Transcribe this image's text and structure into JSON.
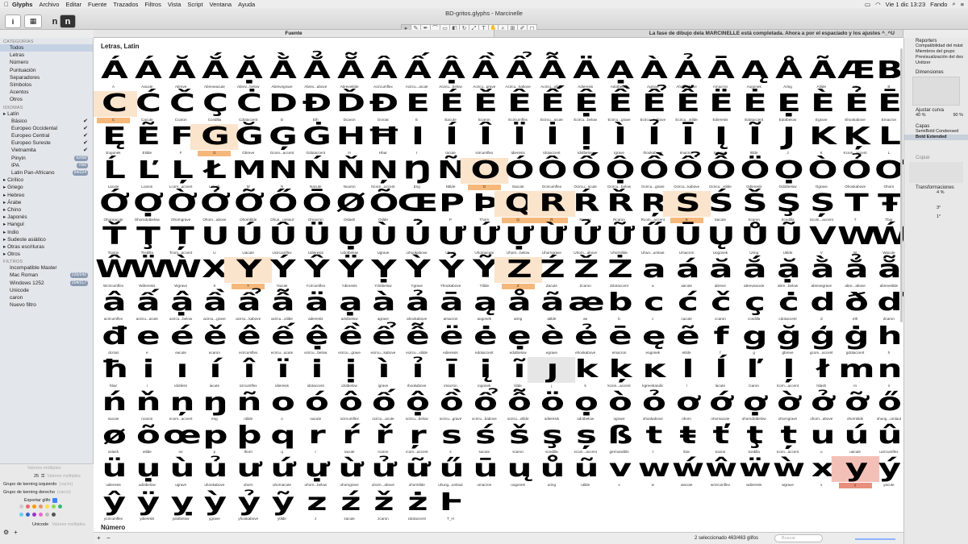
{
  "menubar": {
    "apple": "",
    "items": [
      "Glyphs",
      "Archivo",
      "Editar",
      "Fuente",
      "Trazados",
      "Filtros",
      "Vista",
      "Script",
      "Ventana",
      "Ayuda"
    ],
    "clock": "Vie 1 dic  13:23",
    "user": "Fando"
  },
  "window": {
    "title": "BD-gritos.glyphs - Marcinelle",
    "tabs": [
      "Fuente",
      "La fase de dibujo dela MARCINELLE está  completada. Ahora a por el espaciado y los ajustes ^_^U"
    ]
  },
  "sidebar": {
    "categories_head": "CATEGORÍAS",
    "categories": [
      {
        "label": "Todos",
        "selected": true
      },
      {
        "label": "Letras"
      },
      {
        "label": "Número"
      },
      {
        "label": "Puntuación"
      },
      {
        "label": "Separadores"
      },
      {
        "label": "Símbolos"
      },
      {
        "label": "Acentos"
      },
      {
        "label": "Otros"
      }
    ],
    "languages_head": "IDIOMAS",
    "languages": [
      {
        "label": "Latín",
        "sub": false
      },
      {
        "label": "Básico",
        "sub": true,
        "check": "✔"
      },
      {
        "label": "Europeo Occidental",
        "sub": true,
        "check": "✔"
      },
      {
        "label": "Europeo Central",
        "sub": true,
        "check": "✔"
      },
      {
        "label": "Europeo Sureste",
        "sub": true,
        "check": "✔"
      },
      {
        "label": "Vietnamita",
        "sub": true,
        "check": "✔"
      },
      {
        "label": "Pinyin",
        "sub": true,
        "count": "62/68"
      },
      {
        "label": "IPA",
        "sub": true,
        "count": "7/66"
      },
      {
        "label": "Latin Pan-Africano",
        "sub": true,
        "count": "64/224"
      },
      {
        "label": "Cirílico"
      },
      {
        "label": "Griego"
      },
      {
        "label": "Hebreo"
      },
      {
        "label": "Árabe"
      },
      {
        "label": "Chino"
      },
      {
        "label": "Japonés"
      },
      {
        "label": "Hangul"
      },
      {
        "label": "Indio"
      },
      {
        "label": "Sudeste asiático"
      },
      {
        "label": "Otras escrituras"
      },
      {
        "label": "Otros"
      }
    ],
    "filters_head": "FILTROS",
    "filters": [
      {
        "label": "Incompatible Master"
      },
      {
        "label": "Mac Roman",
        "count": "220/242"
      },
      {
        "label": "Windows 1252",
        "count": "204/217"
      },
      {
        "label": "Unicode"
      },
      {
        "label": "caron"
      },
      {
        "label": "Nuevo filtro"
      }
    ],
    "bottom": {
      "multi1": "Valores múltiples",
      "width_value": "25",
      "multi2": "Valores múltiples",
      "kern_left": "Grupo de kerning izquierdo",
      "kern_left_val": "(vacío)",
      "kern_right": "Grupo de kerning derecho",
      "kern_right_val": "(vacío)",
      "export": "Exportar glifo",
      "unicode": "Unicode",
      "multi3": "Valores múltiples"
    }
  },
  "main": {
    "section1": "Letras, Latin",
    "section2": "Número",
    "footer_count": "2 seleccionado 463/463 glifos",
    "search_placeholder": "Buscar"
  },
  "inspector": {
    "reporters": "Reporters",
    "reporter_items": [
      "Compatibilidad del mást",
      "Miembros del grupo",
      "Previsualización del des",
      "Unitizer"
    ],
    "dimensiones": "Dimensiones",
    "ajustar": "Ajustar curva",
    "ajustar_vals": [
      "40 %",
      "90 %"
    ],
    "capas": "Capas",
    "layers": [
      {
        "label": "SemiBold Condensed",
        "selected": false
      },
      {
        "label": "Bold Extended",
        "selected": true
      }
    ],
    "copiar": "Copiar",
    "transformaciones": "Transformaciones",
    "scale": "4 %",
    "rotate": "3°",
    "slant": "1°"
  },
  "glyph_rows": [
    [
      [
        "Á",
        "A"
      ],
      [
        "Á",
        "Aacute"
      ],
      [
        "Ă",
        "Abreve"
      ],
      [
        "Ắ",
        "Abreveacute"
      ],
      [
        "Ặ",
        "Abrev...below"
      ],
      [
        "Ằ",
        "Abrevegrave"
      ],
      [
        "Ẳ",
        "Abrev...above"
      ],
      [
        "Ẵ",
        "Abrevetilde"
      ],
      [
        "Â",
        "Acircumflex"
      ],
      [
        "Ấ",
        "Acircu...acute"
      ],
      [
        "Ậ",
        "Acircu...below"
      ],
      [
        "Ầ",
        "Acircu...grave"
      ],
      [
        "Ẩ",
        "Acircu...kabove"
      ],
      [
        "Ẫ",
        "Acircu...xtilde"
      ],
      [
        "Ä",
        "Adieresis"
      ],
      [
        "Ạ",
        "Adotbelow"
      ],
      [
        "À",
        "Agrave"
      ],
      [
        "Ả",
        "Ahookabove"
      ],
      [
        "Ā",
        "Amacron"
      ],
      [
        "Ą",
        "Aogonek"
      ],
      [
        "Å",
        "Aring"
      ],
      [
        "Ã",
        "Atilde"
      ],
      [
        "Æ",
        "AE"
      ],
      [
        "B",
        "B"
      ]
    ],
    [
      [
        "C",
        "C",
        "hl"
      ],
      [
        "Ć",
        "Cacute"
      ],
      [
        "Č",
        "Ccaron"
      ],
      [
        "Ç",
        "Ccedilla"
      ],
      [
        "Ċ",
        "Cdotaccent"
      ],
      [
        "D",
        "D"
      ],
      [
        "Ð",
        "Eth"
      ],
      [
        "Ď",
        "Dcaron"
      ],
      [
        "Đ",
        "Dcroat"
      ],
      [
        "E",
        "E"
      ],
      [
        "É",
        "Eacute"
      ],
      [
        "Ě",
        "Ecaron"
      ],
      [
        "Ê",
        "Ecircumflex"
      ],
      [
        "Ế",
        "Ecircu...acute"
      ],
      [
        "Ệ",
        "Ecircu...below"
      ],
      [
        "Ề",
        "Ecircu...grave"
      ],
      [
        "Ể",
        "Ecircu...kabove"
      ],
      [
        "Ễ",
        "Ecircu...xtilde"
      ],
      [
        "Ë",
        "Edieresis"
      ],
      [
        "Ė",
        "Edotaccent"
      ],
      [
        "Ẹ",
        "Edotbelow"
      ],
      [
        "È",
        "Egrave"
      ],
      [
        "Ẻ",
        "Ehookabove"
      ],
      [
        "Ē",
        "Emacron"
      ]
    ],
    [
      [
        "Ę",
        "Eogonek"
      ],
      [
        "Ẽ",
        "Etilde"
      ],
      [
        "F",
        "F"
      ],
      [
        "G",
        "G",
        "hl"
      ],
      [
        "Ğ",
        "Gbreve"
      ],
      [
        "Ģ",
        "Gcom...accent"
      ],
      [
        "Ġ",
        "Gdotaccent"
      ],
      [
        "H",
        "H"
      ],
      [
        "Ħ",
        "Hbar"
      ],
      [
        "I",
        "I"
      ],
      [
        "Í",
        "Iacute"
      ],
      [
        "Î",
        "Icircumflex"
      ],
      [
        "Ï",
        "Idieresis"
      ],
      [
        "İ",
        "Idotaccent"
      ],
      [
        "Ị",
        "Idotbelow"
      ],
      [
        "Ì",
        "Igrave"
      ],
      [
        "Ỉ",
        "Ihookabove"
      ],
      [
        "Ī",
        "Imacron"
      ],
      [
        "Į",
        "Iogonek"
      ],
      [
        "Ĩ",
        "Itilde"
      ],
      [
        "J",
        "J"
      ],
      [
        "K",
        "K"
      ],
      [
        "Ķ",
        "Kcom...accent"
      ],
      [
        "L",
        "L"
      ]
    ],
    [
      [
        "Ĺ",
        "Lacute"
      ],
      [
        "Ľ",
        "Lcaron"
      ],
      [
        "Ļ",
        "Lcom...accent"
      ],
      [
        "Ł",
        "Lslash"
      ],
      [
        "M",
        "M"
      ],
      [
        "N",
        "N"
      ],
      [
        "Ń",
        "Nacute"
      ],
      [
        "Ň",
        "Ncaron"
      ],
      [
        "Ņ",
        "Ncom...accent"
      ],
      [
        "Ŋ",
        "Eng"
      ],
      [
        "Ñ",
        "Ntilde"
      ],
      [
        "O",
        "O",
        "hl"
      ],
      [
        "Ó",
        "Oacute"
      ],
      [
        "Ô",
        "Ocircumflex"
      ],
      [
        "Ố",
        "Ocircu...acute"
      ],
      [
        "Ộ",
        "Ocircu...below"
      ],
      [
        "Ồ",
        "Ocircu...grave"
      ],
      [
        "Ổ",
        "Ocircu...kabove"
      ],
      [
        "Ỗ",
        "Ocircu...xtilde"
      ],
      [
        "Ö",
        "Odieresis"
      ],
      [
        "Ọ",
        "Odotbelow"
      ],
      [
        "Ò",
        "Ograve"
      ],
      [
        "Ỏ",
        "Ohookabove"
      ],
      [
        "Ơ",
        "Ohorn"
      ]
    ],
    [
      [
        "Ớ",
        "Ohornacute"
      ],
      [
        "Ợ",
        "Ohorndotbelow"
      ],
      [
        "Ờ",
        "Ohorngrave"
      ],
      [
        "Ở",
        "Ohorn...above"
      ],
      [
        "Ỡ",
        "Ohorntilde"
      ],
      [
        "Ő",
        "Ohun...umlaut"
      ],
      [
        "Ō",
        "Omacron"
      ],
      [
        "Ø",
        "Oslash"
      ],
      [
        "Õ",
        "Otilde"
      ],
      [
        "Œ",
        "OE"
      ],
      [
        "P",
        "P"
      ],
      [
        "Þ",
        "Thorn"
      ],
      [
        "Q",
        "Q",
        "hl"
      ],
      [
        "R",
        "R",
        "hl"
      ],
      [
        "Ŕ",
        "Racute"
      ],
      [
        "Ř",
        "Rcaron"
      ],
      [
        "Ŗ",
        "Rcom...accent"
      ],
      [
        "S",
        "S",
        "hl"
      ],
      [
        "Ś",
        "Sacute"
      ],
      [
        "Š",
        "Scaron"
      ],
      [
        "Ş",
        "Scedilla"
      ],
      [
        "Ș",
        "Scom...accent"
      ],
      [
        "T",
        "T"
      ],
      [
        "Ŧ",
        "Tbar"
      ]
    ],
    [
      [
        "Ť",
        "Tcaron"
      ],
      [
        "Ţ",
        "Tcedilla"
      ],
      [
        "Ț",
        "Tcom...accent"
      ],
      [
        "U",
        "U"
      ],
      [
        "Ú",
        "Uacute"
      ],
      [
        "Û",
        "Ucircumflex"
      ],
      [
        "Ü",
        "Udieresis"
      ],
      [
        "Ụ",
        "Udotbelow"
      ],
      [
        "Ù",
        "Ugrave"
      ],
      [
        "Ủ",
        "Uhookabove"
      ],
      [
        "Ư",
        "Uhorn"
      ],
      [
        "Ứ",
        "Uhornacute"
      ],
      [
        "Ự",
        "Uhorn...below"
      ],
      [
        "Ừ",
        "Uhorngrave"
      ],
      [
        "Ử",
        "Uhorn...above"
      ],
      [
        "Ữ",
        "Uhorntilde"
      ],
      [
        "Ű",
        "Uhun...umlaut"
      ],
      [
        "Ū",
        "Umacron"
      ],
      [
        "Ų",
        "Uogonek"
      ],
      [
        "Ů",
        "Uring"
      ],
      [
        "Ũ",
        "Utilde"
      ],
      [
        "V",
        "V"
      ],
      [
        "W",
        "W"
      ],
      [
        "Ẃ",
        "Wacute"
      ]
    ],
    [
      [
        "Ŵ",
        "Wcircumflex"
      ],
      [
        "Ẅ",
        "Wdieresis"
      ],
      [
        "Ẁ",
        "Wgrave"
      ],
      [
        "X",
        "X"
      ],
      [
        "Y",
        "Y",
        "hl"
      ],
      [
        "Ý",
        "Yacute"
      ],
      [
        "Ŷ",
        "Ycircumflex"
      ],
      [
        "Ÿ",
        "Ydieresis"
      ],
      [
        "Ỵ",
        "Ydotbelow"
      ],
      [
        "Ỳ",
        "Ygrave"
      ],
      [
        "Ỷ",
        "Yhookabove"
      ],
      [
        "Ỹ",
        "Ytilde"
      ],
      [
        "Z",
        "Z",
        "hl"
      ],
      [
        "Ź",
        "Zacute"
      ],
      [
        "Ž",
        "Zcaron"
      ],
      [
        "Ż",
        "Zdotaccent"
      ],
      [
        "a",
        "a"
      ],
      [
        "á",
        "aacute"
      ],
      [
        "ă",
        "abreve"
      ],
      [
        "ắ",
        "abreveacute"
      ],
      [
        "ặ",
        "abre...below"
      ],
      [
        "ằ",
        "abrevegrave"
      ],
      [
        "ẳ",
        "abre...above"
      ],
      [
        "ẵ",
        "abrevetilde"
      ]
    ],
    [
      [
        "â",
        "acircumflex"
      ],
      [
        "ấ",
        "acircu...acute"
      ],
      [
        "ậ",
        "acircu...below"
      ],
      [
        "ầ",
        "acircu...grave"
      ],
      [
        "ẩ",
        "acircu...kabove"
      ],
      [
        "ẫ",
        "acircu...xtilde"
      ],
      [
        "ä",
        "adieresis"
      ],
      [
        "ạ",
        "adotbelow"
      ],
      [
        "à",
        "agrave"
      ],
      [
        "ả",
        "ahookabove"
      ],
      [
        "ā",
        "amacron"
      ],
      [
        "ą",
        "aogonek"
      ],
      [
        "å",
        "aring"
      ],
      [
        "ã",
        "atilde"
      ],
      [
        "æ",
        "ae"
      ],
      [
        "b",
        "b"
      ],
      [
        "c",
        "c"
      ],
      [
        "ć",
        "cacute"
      ],
      [
        "č",
        "ccaron"
      ],
      [
        "ç",
        "ccedilla"
      ],
      [
        "ċ",
        "cdotaccent"
      ],
      [
        "d",
        "d"
      ],
      [
        "ð",
        "eth"
      ],
      [
        "ď",
        "dcaron"
      ]
    ],
    [
      [
        "đ",
        "dcroat"
      ],
      [
        "e",
        "e"
      ],
      [
        "é",
        "eacute"
      ],
      [
        "ě",
        "ecaron"
      ],
      [
        "ê",
        "ecircumflex"
      ],
      [
        "ế",
        "ecircu...acute"
      ],
      [
        "ệ",
        "ecircu...below"
      ],
      [
        "ề",
        "ecircu...grave"
      ],
      [
        "ể",
        "ecircu...kabove"
      ],
      [
        "ễ",
        "ecircu...xtilde"
      ],
      [
        "ë",
        "edieresis"
      ],
      [
        "ė",
        "edotaccent"
      ],
      [
        "ẹ",
        "edotbelow"
      ],
      [
        "è",
        "egrave"
      ],
      [
        "ẻ",
        "ehookabove"
      ],
      [
        "ē",
        "emacron"
      ],
      [
        "ę",
        "eogonek"
      ],
      [
        "ẽ",
        "etilde"
      ],
      [
        "f",
        "f"
      ],
      [
        "g",
        "g"
      ],
      [
        "ğ",
        "gbreve"
      ],
      [
        "ģ",
        "gcom...accent"
      ],
      [
        "ġ",
        "gdotaccent"
      ],
      [
        "h",
        "h"
      ]
    ],
    [
      [
        "ħ",
        "hbar"
      ],
      [
        "i",
        "i"
      ],
      [
        "ı",
        "idotless"
      ],
      [
        "í",
        "iacute"
      ],
      [
        "î",
        "icircumflex"
      ],
      [
        "ï",
        "idieresis"
      ],
      [
        "i̇",
        "idotaccent"
      ],
      [
        "ị",
        "idotbelow"
      ],
      [
        "ì",
        "igrave"
      ],
      [
        "ỉ",
        "ihookabove"
      ],
      [
        "ī",
        "imacron"
      ],
      [
        "į",
        "iogonek"
      ],
      [
        "ĩ",
        "itilde"
      ],
      [
        "ȷ",
        "j",
        "gray"
      ],
      [
        "k",
        "k"
      ],
      [
        "ķ",
        "kcom...accent"
      ],
      [
        "ĸ",
        "kgreenlandic"
      ],
      [
        "l",
        "l"
      ],
      [
        "ĺ",
        "lacute"
      ],
      [
        "ľ",
        "lcaron"
      ],
      [
        "ļ",
        "lcom...accent"
      ],
      [
        "ł",
        "lslash"
      ],
      [
        "m",
        "m"
      ],
      [
        "n",
        "n"
      ]
    ],
    [
      [
        "ń",
        "nacute"
      ],
      [
        "ň",
        "ncaron"
      ],
      [
        "ņ",
        "ncom...accent"
      ],
      [
        "ŋ",
        "eng"
      ],
      [
        "ñ",
        "ntilde"
      ],
      [
        "o",
        "o"
      ],
      [
        "ó",
        "oacute"
      ],
      [
        "ô",
        "ocircumflex"
      ],
      [
        "ố",
        "ocircu...acute"
      ],
      [
        "ộ",
        "ocircu...below"
      ],
      [
        "ồ",
        "ocircu...grave"
      ],
      [
        "ổ",
        "ocircu...kabove"
      ],
      [
        "ỗ",
        "ocircu...xtilde"
      ],
      [
        "ö",
        "odieresis"
      ],
      [
        "ọ",
        "odotbelow"
      ],
      [
        "ò",
        "ograve"
      ],
      [
        "ỏ",
        "ohookabove"
      ],
      [
        "ơ",
        "ohorn"
      ],
      [
        "ớ",
        "ohornacute"
      ],
      [
        "ợ",
        "ohorndotbelow"
      ],
      [
        "ờ",
        "ohorngrave"
      ],
      [
        "ở",
        "ohorn...above"
      ],
      [
        "ỡ",
        "ohorntilde"
      ],
      [
        "ő",
        "ohung...umlaut"
      ]
    ],
    [
      [
        "ø",
        "oslash"
      ],
      [
        "õ",
        "otilde"
      ],
      [
        "œ",
        "oe"
      ],
      [
        "p",
        "p"
      ],
      [
        "þ",
        "thorn"
      ],
      [
        "q",
        "q"
      ],
      [
        "r",
        "r"
      ],
      [
        "ŕ",
        "racute"
      ],
      [
        "ř",
        "rcaron"
      ],
      [
        "ŗ",
        "rcom...accent"
      ],
      [
        "s",
        "s"
      ],
      [
        "ś",
        "sacute"
      ],
      [
        "š",
        "scaron"
      ],
      [
        "ş",
        "scedilla"
      ],
      [
        "ș",
        "scom...accent"
      ],
      [
        "ß",
        "germandbls"
      ],
      [
        "t",
        "t"
      ],
      [
        "ŧ",
        "tbar"
      ],
      [
        "ť",
        "tcaron"
      ],
      [
        "ţ",
        "tcedilla"
      ],
      [
        "ț",
        "tcom...accent"
      ],
      [
        "u",
        "u"
      ],
      [
        "ú",
        "uacute"
      ],
      [
        "û",
        "ucircumflex"
      ]
    ],
    [
      [
        "ü",
        "udieresis"
      ],
      [
        "ụ",
        "udotbelow"
      ],
      [
        "ù",
        "ugrave"
      ],
      [
        "ủ",
        "uhookabove"
      ],
      [
        "ư",
        "uhorn"
      ],
      [
        "ứ",
        "uhornacute"
      ],
      [
        "ự",
        "uhorn...below"
      ],
      [
        "ừ",
        "uhorngrave"
      ],
      [
        "ử",
        "uhorn...above"
      ],
      [
        "ữ",
        "uhorntilde"
      ],
      [
        "ű",
        "uhung...umlaut"
      ],
      [
        "ū",
        "umacron"
      ],
      [
        "ų",
        "uogonek"
      ],
      [
        "ů",
        "uring"
      ],
      [
        "ũ",
        "utilde"
      ],
      [
        "v",
        "v"
      ],
      [
        "w",
        "w"
      ],
      [
        "ẃ",
        "wacute"
      ],
      [
        "ŵ",
        "wcircumflex"
      ],
      [
        "ẅ",
        "wdieresis"
      ],
      [
        "ẁ",
        "wgrave"
      ],
      [
        "x",
        "x"
      ],
      [
        "y",
        "y",
        "hl2"
      ],
      [
        "ý",
        "yacute"
      ]
    ],
    [
      [
        "ŷ",
        "ycircumflex"
      ],
      [
        "ÿ",
        "ydieresis"
      ],
      [
        "ỵ",
        "ydotbelow"
      ],
      [
        "ỳ",
        "ygrave"
      ],
      [
        "ỷ",
        "yhookabove"
      ],
      [
        "ỹ",
        "ytilde"
      ],
      [
        "z",
        "z"
      ],
      [
        "ź",
        "zacute"
      ],
      [
        "ž",
        "zcaron"
      ],
      [
        "ż",
        "zdotaccent"
      ],
      [
        "Ⱶ",
        "T_H"
      ]
    ]
  ]
}
